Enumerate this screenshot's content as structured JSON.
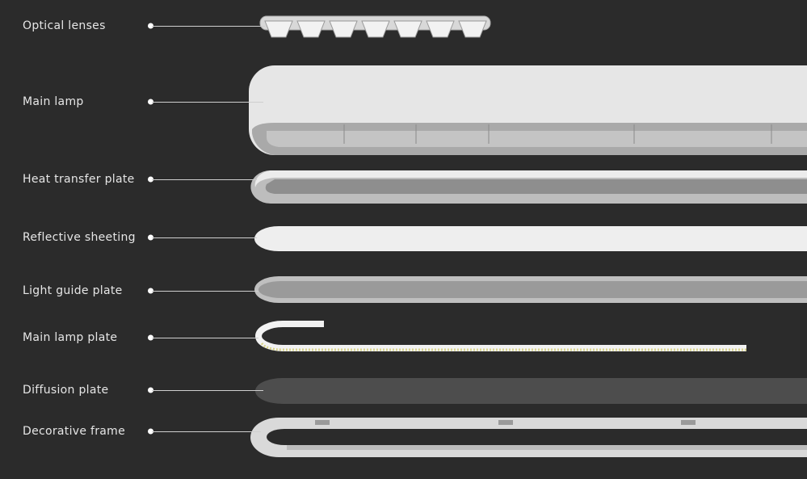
{
  "components": [
    {
      "label": "Optical lenses"
    },
    {
      "label": "Main lamp"
    },
    {
      "label": "Heat transfer plate"
    },
    {
      "label": "Reflective sheeting"
    },
    {
      "label": "Light guide plate"
    },
    {
      "label": "Main lamp plate"
    },
    {
      "label": "Diffusion plate"
    },
    {
      "label": "Decorative frame"
    }
  ],
  "colors": {
    "background": "#2b2b2b",
    "part_light": "#e8e8e8",
    "led_strip": "#e8e3a8",
    "diffusion": "#4d4d4d"
  }
}
